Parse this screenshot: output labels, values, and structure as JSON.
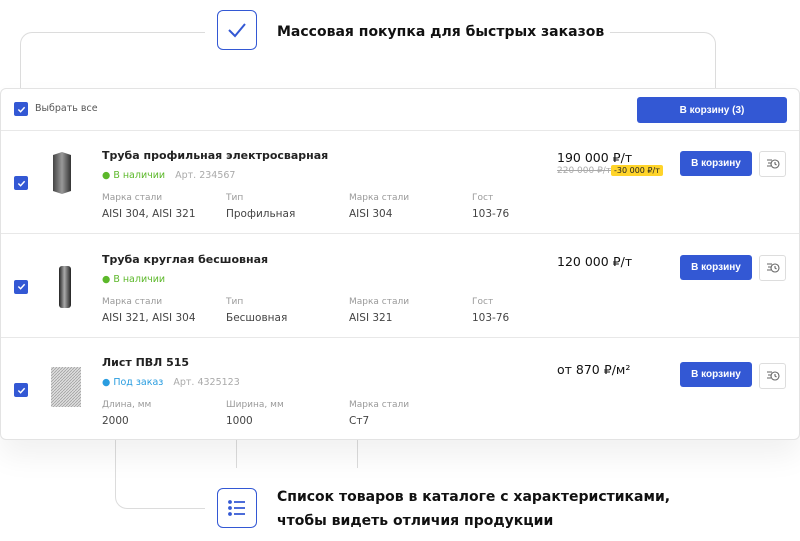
{
  "top_callout": {
    "text": "Массовая покупка для быстрых заказов",
    "icon": "checkmark-icon"
  },
  "bottom_callout": {
    "line1": "Список товаров в каталоге с характеристиками,",
    "line2": "чтобы видеть отличия продукции",
    "icon": "list-icon"
  },
  "header": {
    "select_all": "Выбрать все",
    "select_all_checked": true,
    "cart_button": "В корзину (3)"
  },
  "colors": {
    "accent": "#3358d4",
    "in_stock": "#5cb82a",
    "on_order": "#2a9de0",
    "discount_badge": "#ffd42a"
  },
  "products": [
    {
      "title": "Труба профильная электросварная",
      "status": "В наличии",
      "status_type": "in_stock",
      "article": "Арт. 234567",
      "price": "190 000 ₽/т",
      "old_price": "220 000 ₽/т",
      "discount": "-30 000 ₽/т",
      "checked": true,
      "button": "В корзину",
      "specs": [
        {
          "label": "Марка стали",
          "value": "AISI 304, AISI 321"
        },
        {
          "label": "Тип",
          "value": "Профильная"
        },
        {
          "label": "Марка стали",
          "value": "AISI 304"
        },
        {
          "label": "Гост",
          "value": "103-76"
        }
      ]
    },
    {
      "title": "Труба круглая бесшовная",
      "status": "В наличии",
      "status_type": "in_stock",
      "article": "",
      "price": "120 000 ₽/т",
      "checked": true,
      "button": "В корзину",
      "specs": [
        {
          "label": "Марка стали",
          "value": "AISI 321, AISI 304"
        },
        {
          "label": "Тип",
          "value": "Бесшовная"
        },
        {
          "label": "Марка стали",
          "value": "AISI 321"
        },
        {
          "label": "Гост",
          "value": "103-76"
        }
      ]
    },
    {
      "title": "Лист ПВЛ 515",
      "status": "Под заказ",
      "status_type": "on_order",
      "article": "Арт. 4325123",
      "price": "от 870 ₽/м²",
      "checked": true,
      "button": "В корзину",
      "specs": [
        {
          "label": "Длина, мм",
          "value": "2000"
        },
        {
          "label": "Ширина, мм",
          "value": "1000"
        },
        {
          "label": "Марка стали",
          "value": "Ст7"
        }
      ]
    }
  ]
}
